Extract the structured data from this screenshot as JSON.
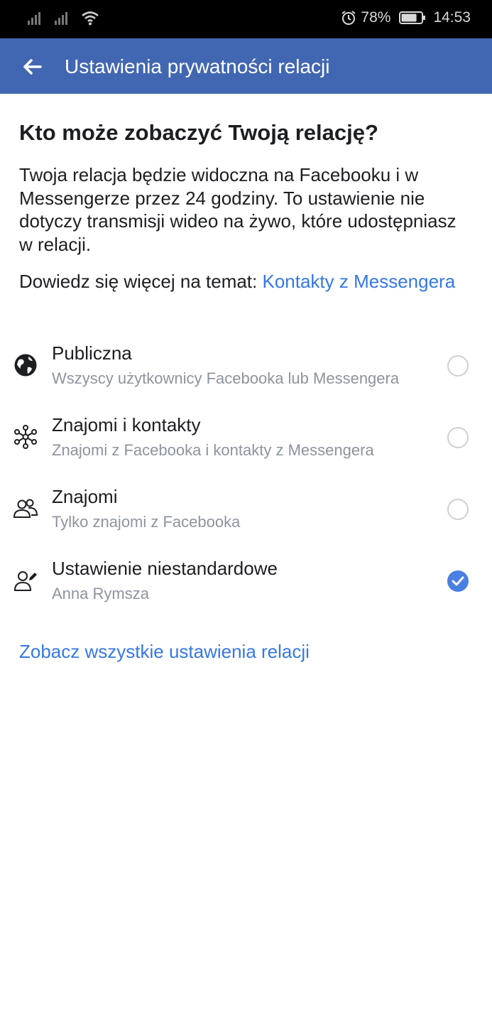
{
  "status_bar": {
    "battery_percent": "78%",
    "time": "14:53",
    "icons": [
      "signal-icon",
      "signal-icon",
      "wifi-icon",
      "alarm-icon",
      "battery-icon"
    ],
    "battery_level": 0.78
  },
  "app_bar": {
    "title": "Ustawienia prywatności relacji",
    "back_icon": "back-arrow-icon",
    "color": "#4267b2"
  },
  "main": {
    "heading": "Kto może zobaczyć Twoją relację?",
    "description": "Twoja relacja będzie widoczna na Facebooku i w Messengerze przez 24 godziny. To ustawienie nie dotyczy transmisji wideo na żywo, które udostępniasz w relacji.",
    "learn_more_prefix": "Dowiedz się więcej na temat: ",
    "learn_more_link": "Kontakty z Messengera",
    "options": [
      {
        "title": "Publiczna",
        "subtitle": "Wszyscy użytkownicy Facebooka lub Messengera",
        "icon": "globe-icon",
        "selected": false
      },
      {
        "title": "Znajomi i kontakty",
        "subtitle": "Znajomi z Facebooka i kontakty z Messengera",
        "icon": "network-icon",
        "selected": false
      },
      {
        "title": "Znajomi",
        "subtitle": "Tylko znajomi z Facebooka",
        "icon": "friends-icon",
        "selected": false
      },
      {
        "title": "Ustawienie niestandardowe",
        "subtitle": "Anna Rymsza",
        "icon": "custom-person-icon",
        "selected": true
      }
    ],
    "see_all_link": "Zobacz wszystkie ustawienia relacji"
  },
  "colors": {
    "link": "#3578e5",
    "radio_selected": "#4a7fe3",
    "subtitle": "#8d949e"
  }
}
